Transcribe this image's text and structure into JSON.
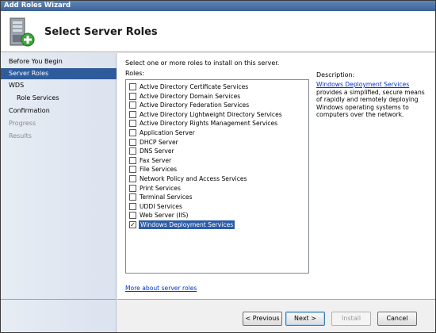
{
  "window": {
    "title": "Add Roles Wizard"
  },
  "header": {
    "title": "Select Server Roles",
    "icon": "server-add-icon"
  },
  "sidebar": {
    "items": [
      {
        "label": "Before You Begin",
        "state": "normal"
      },
      {
        "label": "Server Roles",
        "state": "active"
      },
      {
        "label": "WDS",
        "state": "normal"
      },
      {
        "label": "Role Services",
        "state": "normal",
        "sub": true
      },
      {
        "label": "Confirmation",
        "state": "normal"
      },
      {
        "label": "Progress",
        "state": "disabled"
      },
      {
        "label": "Results",
        "state": "disabled"
      }
    ]
  },
  "main": {
    "instructions": "Select one or more roles to install on this server.",
    "roles_label": "Roles:",
    "roles": [
      {
        "label": "Active Directory Certificate Services",
        "checked": false
      },
      {
        "label": "Active Directory Domain Services",
        "checked": false
      },
      {
        "label": "Active Directory Federation Services",
        "checked": false
      },
      {
        "label": "Active Directory Lightweight Directory Services",
        "checked": false
      },
      {
        "label": "Active Directory Rights Management Services",
        "checked": false
      },
      {
        "label": "Application Server",
        "checked": false
      },
      {
        "label": "DHCP Server",
        "checked": false
      },
      {
        "label": "DNS Server",
        "checked": false
      },
      {
        "label": "Fax Server",
        "checked": false
      },
      {
        "label": "File Services",
        "checked": false
      },
      {
        "label": "Network Policy and Access Services",
        "checked": false
      },
      {
        "label": "Print Services",
        "checked": false
      },
      {
        "label": "Terminal Services",
        "checked": false
      },
      {
        "label": "UDDI Services",
        "checked": false
      },
      {
        "label": "Web Server (IIS)",
        "checked": false
      },
      {
        "label": "Windows Deployment Services",
        "checked": true,
        "selected": true
      }
    ],
    "description": {
      "heading": "Description:",
      "link_text": "Windows Deployment Services",
      "text": "provides a simplified, secure means of rapidly and remotely deploying Windows operating systems to computers over the network."
    },
    "more_link": "More about server roles"
  },
  "footer": {
    "previous": "< Previous",
    "next": "Next >",
    "install": "Install",
    "cancel": "Cancel"
  },
  "colors": {
    "accent": "#2e5b9b",
    "link": "#0033cc"
  }
}
